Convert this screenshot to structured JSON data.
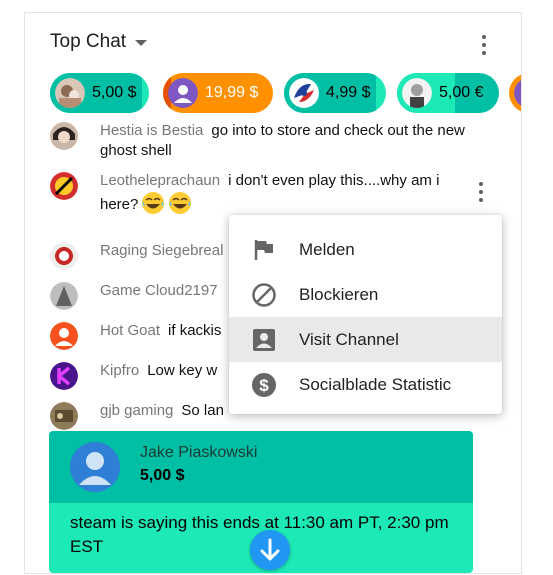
{
  "header": {
    "title": "Top Chat",
    "title_icon": "chevron-down-icon",
    "menu_icon": "more-vert-icon"
  },
  "tickers": [
    {
      "amount": "5,00 $",
      "bg": "#1de9b6",
      "fill": "#00bfa5",
      "text_color": "#000000"
    },
    {
      "amount": "19,99 $",
      "bg": "#ff9100",
      "fill": "#e65100",
      "text_color": "#ffffff"
    },
    {
      "amount": "4,99 $",
      "bg": "#1de9b6",
      "fill": "#00bfa5",
      "text_color": "#000000"
    },
    {
      "amount": "5,00 €",
      "bg": "#00bfa5",
      "fill": "#1de9b6",
      "text_color": "#000000"
    },
    {
      "amount": "",
      "bg": "#ff9100",
      "fill": "#e65100",
      "text_color": "#ffffff"
    }
  ],
  "messages": [
    {
      "author": "Hestia is Bestia",
      "text": "go into to store and check out the new ghost shell"
    },
    {
      "author": "Leotheleprachaun",
      "text": "i don't even play this....why am i here?"
    },
    {
      "author": "Raging Siegebreal",
      "text": ""
    },
    {
      "author": "Game Cloud2197",
      "text": ""
    },
    {
      "author": "Hot Goat",
      "text": "if kackis"
    },
    {
      "author": "Kipfro",
      "text": "Low key w"
    },
    {
      "author": "gjb gaming",
      "text": "So lan"
    }
  ],
  "context_menu": {
    "items": [
      {
        "label": "Melden",
        "icon": "flag-icon"
      },
      {
        "label": "Blockieren",
        "icon": "block-icon"
      },
      {
        "label": "Visit Channel",
        "icon": "account-box-icon"
      },
      {
        "label": "Socialblade Statistic",
        "icon": "dollar-icon"
      }
    ],
    "highlighted": "Visit Channel"
  },
  "paid_message": {
    "author": "Jake Piaskowski",
    "amount": "5,00 $",
    "text": "steam is saying this ends at 11:30 am PT, 2:30 pm EST",
    "header_color": "#00bfa5",
    "body_color": "#1de9b6"
  },
  "accent_color": "#2196f3"
}
